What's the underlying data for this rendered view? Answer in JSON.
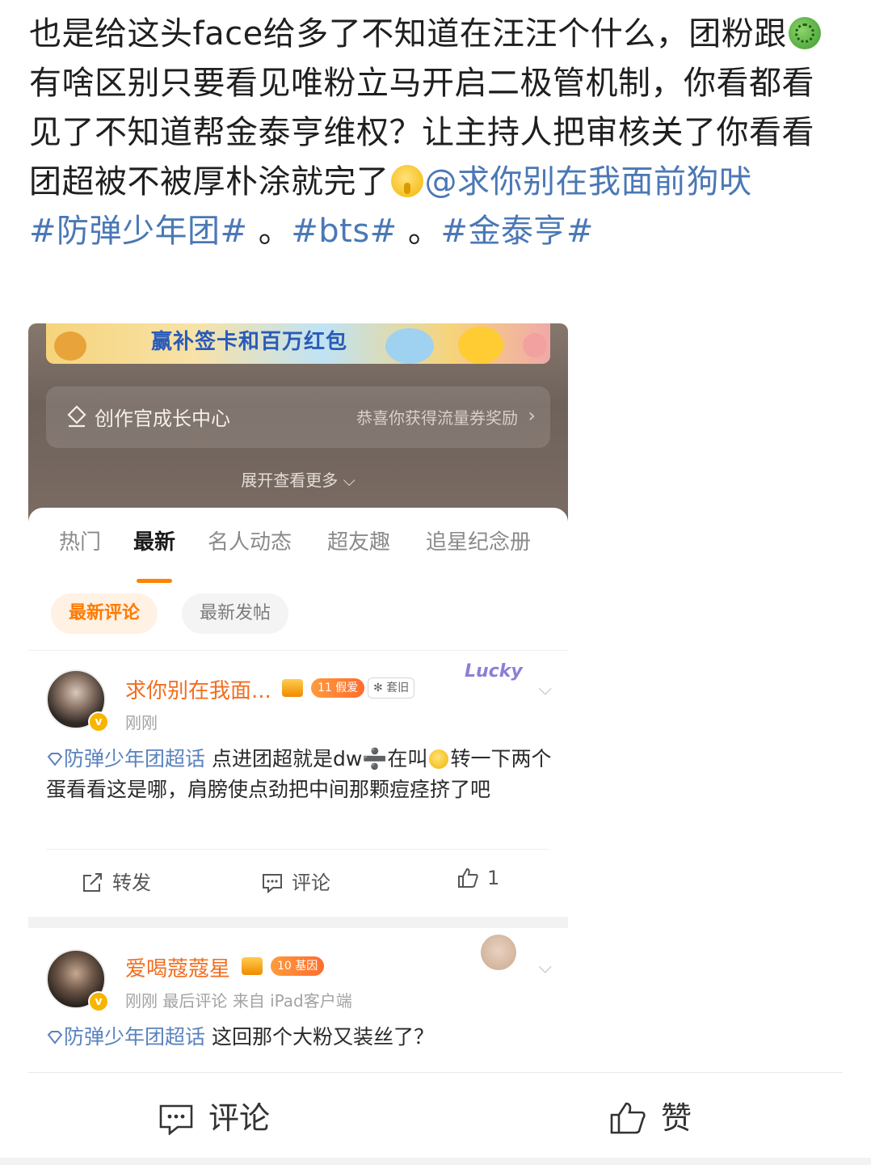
{
  "post": {
    "text_part1": "也是给这头face给多了不知道在汪汪个什么，团粉跟",
    "emoji_germ": "germ-emoji",
    "text_part2": "有啥区别只要看见唯粉立马开启二极管机制，你看都看见了不知道帮金泰亨维权？让主持人把审核关了你看看团超被不被厚朴涂就完了",
    "emoji_shush": "shushing-face-emoji",
    "mention": "@求你别在我面前狗吠",
    "tags": [
      "#防弹少年团#",
      "#bts#",
      "#金泰亨#"
    ],
    "tag_separator": " 。"
  },
  "screenshot": {
    "banner_text": "赢补签卡和百万红包",
    "growth": {
      "title": "创作官成长中心",
      "right_text": "恭喜你获得流量券奖励",
      "chevron": "›"
    },
    "expand_text": "展开查看更多 ⌵",
    "tabs": [
      "热门",
      "最新",
      "名人动态",
      "超友趣",
      "追星纪念册"
    ],
    "active_tab": "最新",
    "chips": [
      "最新评论",
      "最新发帖"
    ],
    "comments": [
      {
        "username": "求你别在我面...",
        "level_badge": "11 假爱",
        "extra_badge": "✻ 套旧",
        "decoration": "Lucky",
        "meta": "刚刚",
        "chaohua": "防弹少年团超话",
        "text_a": " 点进团超就是dw",
        "div_sign": "➗",
        "text_b": "在叫",
        "text_c": "转一下两个蛋看看这是哪，肩膀使点劲把中间那颗痘痉挤了吧",
        "actions": {
          "repost": "转发",
          "comment": "评论",
          "like_count": "1"
        }
      },
      {
        "username": "爱喝蔻蔻星",
        "level_badge": "10 基因",
        "meta": "刚刚 最后评论  来自 iPad客户端",
        "chaohua": "防弹少年团超话",
        "text": " 这回那个大粉又装丝了？"
      }
    ]
  },
  "bottom_bar": {
    "comment": "评论",
    "like": "赞"
  },
  "colors": {
    "link_blue": "#4a78b5",
    "accent_orange": "#ff8200",
    "username_orange": "#f26d1f"
  }
}
